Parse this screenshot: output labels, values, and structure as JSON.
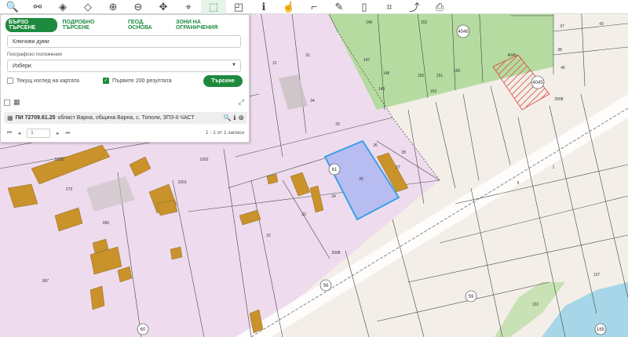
{
  "toolbar": {
    "tools": [
      {
        "icon": "search-icon",
        "glyph": "🔍",
        "active": false
      },
      {
        "icon": "measure-icon",
        "glyph": "⚯",
        "active": false
      },
      {
        "icon": "layers-icon",
        "glyph": "◈",
        "active": false
      },
      {
        "icon": "layers-stack-icon",
        "glyph": "◇",
        "active": false
      },
      {
        "icon": "zoom-in-icon",
        "glyph": "⊕",
        "active": false
      },
      {
        "icon": "zoom-out-icon",
        "glyph": "⊖",
        "active": false
      },
      {
        "icon": "pan-icon",
        "glyph": "✥",
        "active": false
      },
      {
        "icon": "location-pin-icon",
        "glyph": "⌖",
        "active": false
      },
      {
        "icon": "select-area-icon",
        "glyph": "⬚",
        "active": true
      },
      {
        "icon": "select-rect-icon",
        "glyph": "◰",
        "active": false
      },
      {
        "icon": "info-icon",
        "glyph": "ℹ",
        "active": false
      },
      {
        "icon": "identify-icon",
        "glyph": "☝",
        "active": false
      },
      {
        "icon": "corner-icon",
        "glyph": "⌐",
        "active": false
      },
      {
        "icon": "draw-icon",
        "glyph": "✎",
        "active": false
      },
      {
        "icon": "map-icon",
        "glyph": "▯",
        "active": false
      },
      {
        "icon": "coordinates-icon",
        "glyph": "⌗",
        "active": false
      },
      {
        "icon": "share-icon",
        "glyph": "⤴",
        "active": false
      },
      {
        "icon": "print-icon",
        "glyph": "⎙",
        "active": false
      }
    ]
  },
  "panel": {
    "tabs": [
      "БЪРЗО ТЪРСЕНЕ",
      "ПОДРОБНО ТЪРСЕНЕ",
      "ГЕОД. ОСНОВА",
      "ЗОНИ НА ОГРАНИЧЕНИЯ"
    ],
    "keywords_placeholder": "Ключови думи",
    "geo_label": "Географско положение",
    "geo_value": "Избери",
    "current_view_label": "Текущ изглед на картата",
    "first200_label": "Първите 200 резултата",
    "search_button": "Търсене",
    "result_title": "ПИ 72709.61.25",
    "result_desc": "област Варна, община Варна, с. Тополи, ЗПЗ-II ЧАСТ",
    "page_value": "1",
    "records_info": "1 - 1 от 1 записи"
  },
  "map": {
    "colors": {
      "urban": "#eedcee",
      "forest": "#b5dba0",
      "agri": "#f3efe8",
      "building": "#c9922b",
      "selected": "#b7bdf0",
      "selected_border": "#3aa0e6",
      "hatch": "#e04040",
      "water": "#a7d6e8"
    },
    "labels": [
      "1023",
      "273",
      "990",
      "997",
      "1001",
      "1002",
      "31",
      "34",
      "33",
      "26",
      "27",
      "28",
      "25",
      "24",
      "23",
      "22",
      "21",
      "147",
      "148",
      "149",
      "146",
      "150",
      "151",
      "152",
      "153",
      "155",
      "144",
      "4046",
      "4045",
      "40",
      "43",
      "38",
      "37",
      "61",
      "60",
      "56",
      "59",
      "165",
      "2008",
      "122",
      "127",
      "1",
      "5"
    ],
    "circle_labels": [
      "61",
      "60",
      "56",
      "59",
      "165",
      "4046",
      "4045"
    ]
  }
}
